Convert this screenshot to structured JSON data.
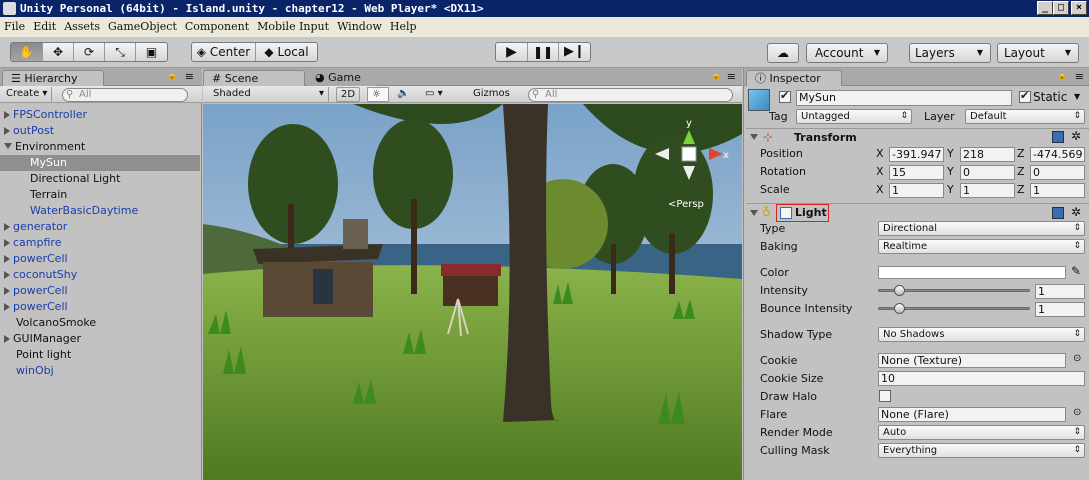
{
  "window": {
    "title": "Unity Personal (64bit) - Island.unity - chapter12 - Web Player* <DX11>"
  },
  "menu": [
    "File",
    "Edit",
    "Assets",
    "GameObject",
    "Component",
    "Mobile Input",
    "Window",
    "Help"
  ],
  "toolbar": {
    "pivot_center": "Center",
    "pivot_local": "Local",
    "account": "Account",
    "layers": "Layers",
    "layout": "Layout"
  },
  "hierarchy": {
    "tab": "Hierarchy",
    "create": "Create",
    "search_placeholder": "All",
    "items": [
      {
        "label": "FPSController",
        "indent": 0,
        "arrow": "closed",
        "color": "blue",
        "selected": false
      },
      {
        "label": "outPost",
        "indent": 0,
        "arrow": "closed",
        "color": "blue",
        "selected": false
      },
      {
        "label": "Environment",
        "indent": 0,
        "arrow": "open",
        "color": "black",
        "selected": false
      },
      {
        "label": "MySun",
        "indent": 1,
        "arrow": "none",
        "color": "black",
        "selected": true
      },
      {
        "label": "Directional Light",
        "indent": 1,
        "arrow": "none",
        "color": "black",
        "selected": false
      },
      {
        "label": "Terrain",
        "indent": 1,
        "arrow": "none",
        "color": "black",
        "selected": false
      },
      {
        "label": "WaterBasicDaytime",
        "indent": 1,
        "arrow": "none",
        "color": "blue",
        "selected": false
      },
      {
        "label": "generator",
        "indent": 0,
        "arrow": "closed",
        "color": "blue",
        "selected": false
      },
      {
        "label": "campfire",
        "indent": 0,
        "arrow": "closed",
        "color": "blue",
        "selected": false
      },
      {
        "label": "powerCell",
        "indent": 0,
        "arrow": "closed",
        "color": "blue",
        "selected": false
      },
      {
        "label": "coconutShy",
        "indent": 0,
        "arrow": "closed",
        "color": "blue",
        "selected": false
      },
      {
        "label": "powerCell",
        "indent": 0,
        "arrow": "closed",
        "color": "blue",
        "selected": false
      },
      {
        "label": "powerCell",
        "indent": 0,
        "arrow": "closed",
        "color": "blue",
        "selected": false
      },
      {
        "label": "VolcanoSmoke",
        "indent": 0,
        "arrow": "none",
        "color": "black",
        "selected": false
      },
      {
        "label": "GUIManager",
        "indent": 0,
        "arrow": "closed",
        "color": "black",
        "selected": false
      },
      {
        "label": "Point light",
        "indent": 0,
        "arrow": "none",
        "color": "black",
        "selected": false
      },
      {
        "label": "winObj",
        "indent": 0,
        "arrow": "none",
        "color": "blue",
        "selected": false
      }
    ]
  },
  "scene": {
    "tab_scene": "Scene",
    "tab_game": "Game",
    "shading": "Shaded",
    "mode2d": "2D",
    "gizmos": "Gizmos",
    "search_placeholder": "All",
    "persp": "Persp",
    "axis_y": "y",
    "axis_x": "x"
  },
  "inspector": {
    "tab": "Inspector",
    "object_name": "MySun",
    "static_label": "Static",
    "tag_label": "Tag",
    "tag_value": "Untagged",
    "layer_label": "Layer",
    "layer_value": "Default",
    "transform": {
      "title": "Transform",
      "position_label": "Position",
      "rotation_label": "Rotation",
      "scale_label": "Scale",
      "axis_x": "X",
      "axis_y": "Y",
      "axis_z": "Z",
      "position": [
        "-391.947",
        "218",
        "-474.569"
      ],
      "rotation": [
        "15",
        "0",
        "0"
      ],
      "scale": [
        "1",
        "1",
        "1"
      ]
    },
    "light": {
      "title": "Light",
      "type_label": "Type",
      "type_value": "Directional",
      "baking_label": "Baking",
      "baking_value": "Realtime",
      "color_label": "Color",
      "color_value": "#ffffff",
      "intensity_label": "Intensity",
      "intensity_value": "1",
      "bounce_label": "Bounce Intensity",
      "bounce_value": "1",
      "shadow_label": "Shadow Type",
      "shadow_value": "No Shadows",
      "cookie_label": "Cookie",
      "cookie_value": "None (Texture)",
      "cookie_size_label": "Cookie Size",
      "cookie_size_value": "10",
      "draw_halo_label": "Draw Halo",
      "flare_label": "Flare",
      "flare_value": "None (Flare)",
      "render_mode_label": "Render Mode",
      "render_mode_value": "Auto",
      "culling_label": "Culling Mask",
      "culling_value": "Everything"
    }
  }
}
